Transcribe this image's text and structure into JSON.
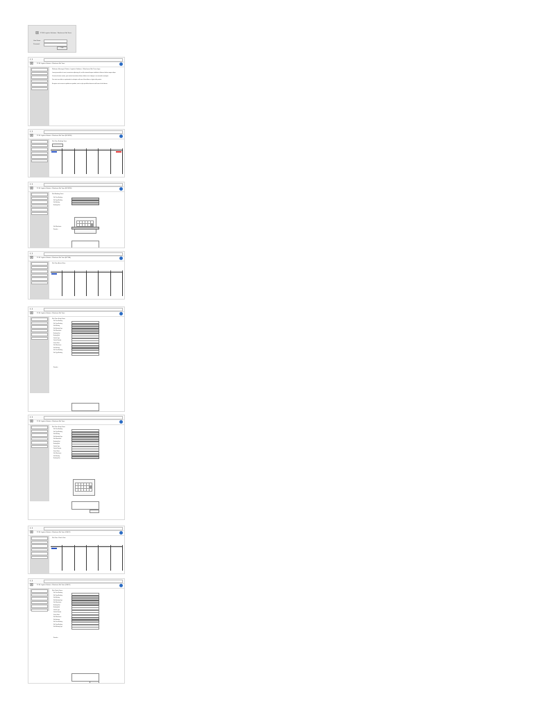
{
  "login": {
    "title": "P1 IBL Logistics Solutions - Warehouse Slot Times",
    "user_label": "User Name:",
    "pass_label": "Password:",
    "login_button": "Login"
  },
  "screens": [
    {
      "title": "P1 IBL Logistics Solutions - Warehouse Slot Times",
      "heading": "Welcome Message & Notice: Logistics Solutions - Warehouse Slot Times login",
      "paragraphs": [
        "Lorem ipsum dolor sit amet, consectetur adipiscing elit, sed do eiusmod tempor incididunt ut labore et dolore magna aliqua.",
        "Ut enim ad minim veniam, quis nostrud exercitation ullamco laboris nisi ut aliquip ex ea commodo consequat.",
        "Duis aute irure dolor in reprehenderit in voluptate velit esse cillum dolore eu fugiat nulla pariatur.",
        "Excepteur sint occaecat cupidatat non proident, sunt in culpa qui officia deserunt mollit anim id est laborum."
      ]
    },
    {
      "title": "P1 IBL Logistics Solutions - Warehouse Slot Times (BOOKING)",
      "heading": "Slot Time Booking View"
    },
    {
      "title": "P1 IBL Logistics Solutions - Warehouse Slot Times (BOOKING)",
      "heading": "Slot Booking Form"
    },
    {
      "title": "P1 IBL Logistics Solutions - Warehouse Slot Times (ACTUAL)",
      "heading": "Slot Time Actual View"
    },
    {
      "title": "P1 IBL Logistics Solutions - Warehouse Slot Times",
      "heading": "Slot Time Entry Form"
    },
    {
      "title": "P1 IBL Logistics Solutions - Warehouse Slot Times",
      "heading": "Slot Time Entry Form"
    },
    {
      "title": "P1 IBL Logistics Solutions - Warehouse Slot Times (CHECK)",
      "heading": "Slot Time Check View"
    },
    {
      "title": "P1 IBL Logistics Solutions - Warehouse Slot Times (CHECK)",
      "heading": "Slot Check Form"
    }
  ],
  "sidebar_items": [
    "Home",
    "Booking",
    "Actual",
    "Check",
    "Reports",
    "Logout"
  ],
  "form_labels": [
    "Slot Time Booking",
    "Slot Type Booking",
    "Slot Booking",
    "Slot Booking Type",
    "Slot Warehouse",
    "Booking Start",
    "Booking End",
    "Vehicle Type",
    "Vehicle Number",
    "Driver Name",
    "Remarks"
  ],
  "submit_label": "Submit",
  "colors": {
    "accent": "#2b55c4",
    "alert": "#dd3333",
    "sidebar": "#d9d9d9"
  }
}
